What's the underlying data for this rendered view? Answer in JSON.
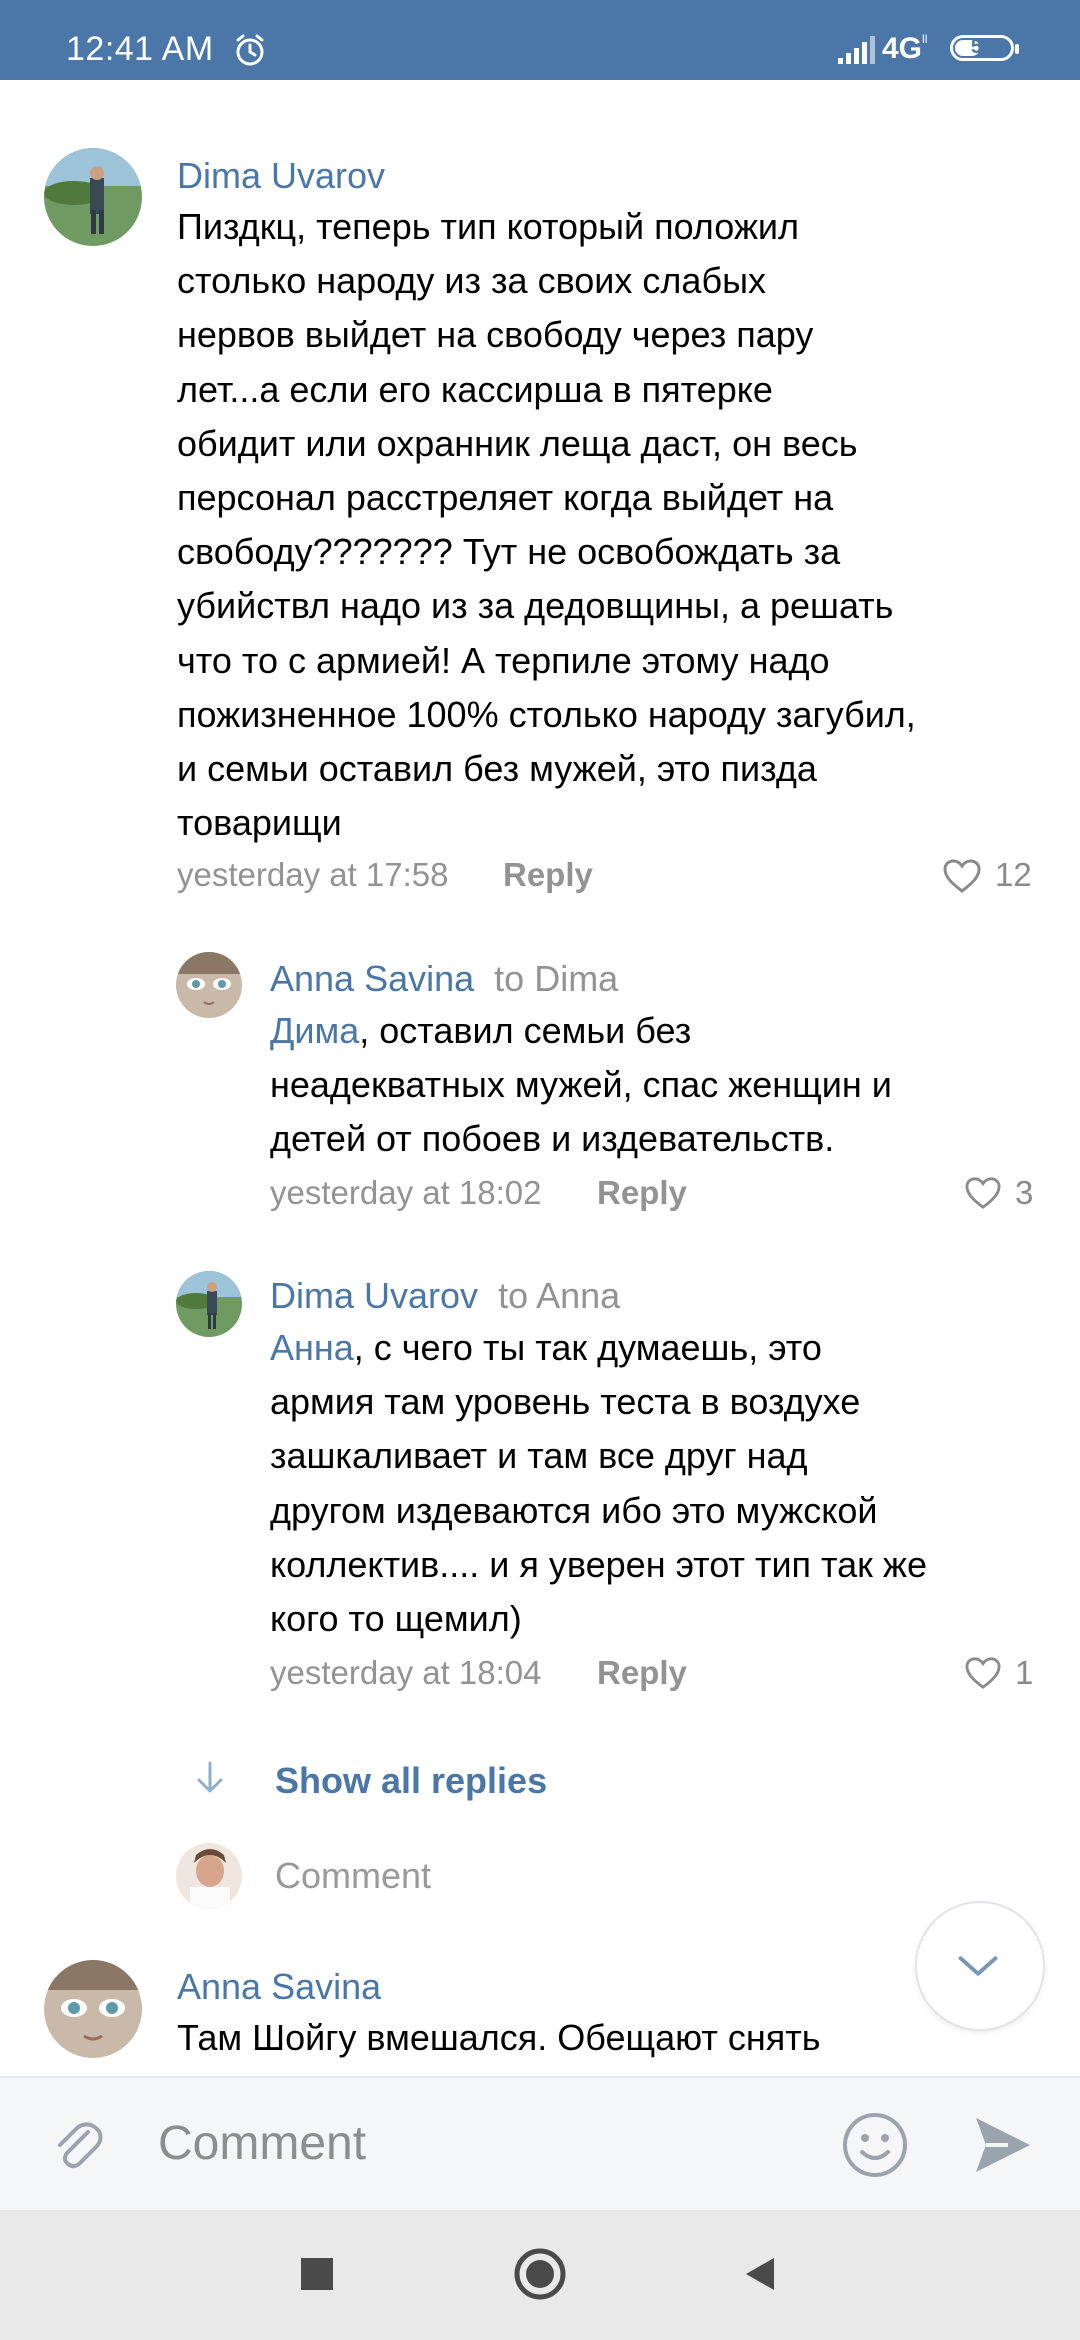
{
  "status_bar": {
    "time": "12:41 AM",
    "network": "4G",
    "network_sub": "ll",
    "battery": "50",
    "battery_level": 0.5
  },
  "comments": [
    {
      "author": "Dima Uvarov",
      "text_lines": [
        "Пиздкц, теперь тип который положил",
        "столько народу из за своих слабых",
        "нервов выйдет на свободу через пару",
        "лет...а если его кассирша в пятерке",
        "обидит или охранник леща даст, он весь",
        "персонал расстреляет когда выйдет на",
        "свободу??????? Тут не освобождать за",
        "убийствл надо из за дедовщины, а решать",
        "что то с армией! А терпиле этому надо",
        "пожизненное 100% столько народу загубил,",
        "и семьи оставил без мужей, это пизда",
        "товарищи"
      ],
      "time": "yesterday at 17:58",
      "reply_label": "Reply",
      "likes": "12"
    }
  ],
  "replies": [
    {
      "author": "Anna Savina",
      "to": "to Dima",
      "mention": "Дима",
      "first_line_rest": ", оставил семьи без",
      "text_lines": [
        "неадекватных мужей, спас женщин и",
        "детей от побоев и издевательств."
      ],
      "time": "yesterday at 18:02",
      "reply_label": "Reply",
      "likes": "3"
    },
    {
      "author": "Dima Uvarov",
      "to": "to Anna",
      "mention": "Анна",
      "first_line_rest": ", с чего ты так думаешь, это",
      "text_lines": [
        "армия там уровень теста в воздухе",
        "зашкаливает и там все друг над",
        "другом издеваются ибо это мужской",
        "коллектив.... и я уверен этот тип так же",
        "кого то щемил)"
      ],
      "time": "yesterday at 18:04",
      "reply_label": "Reply",
      "likes": "1"
    }
  ],
  "show_all_replies": "Show all replies",
  "inline_comment_placeholder": "Comment",
  "next_comment": {
    "author": "Anna Savina",
    "text": "Там Шойгу вмешался. Обещают снять"
  },
  "composer": {
    "placeholder": "Comment"
  },
  "colors": {
    "accent": "#4a76a8",
    "meta": "#939393",
    "text": "#000000"
  },
  "icons": [
    "alarm-icon",
    "signal-icon",
    "battery-icon",
    "heart-icon",
    "arrow-down-icon",
    "chevron-down-icon",
    "paperclip-icon",
    "smile-icon",
    "send-icon",
    "recent-apps-icon",
    "home-icon",
    "back-icon"
  ]
}
